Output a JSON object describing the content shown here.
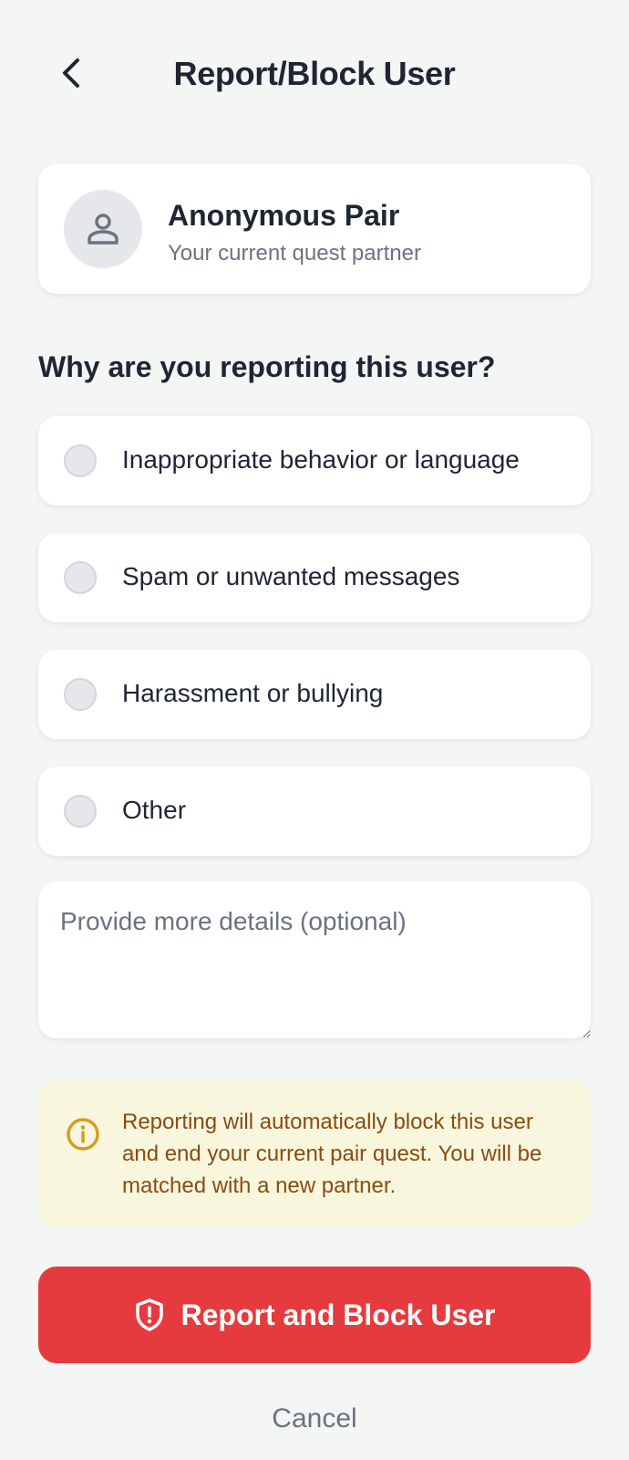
{
  "header": {
    "title": "Report/Block User",
    "back_icon": "chevron-left-icon"
  },
  "user_card": {
    "avatar_icon": "person-icon",
    "name": "Anonymous Pair",
    "subtitle": "Your current quest partner"
  },
  "question": "Why are you reporting this user?",
  "options": [
    {
      "label": "Inappropriate behavior or language",
      "selected": false
    },
    {
      "label": "Spam or unwanted messages",
      "selected": false
    },
    {
      "label": "Harassment or bullying",
      "selected": false
    },
    {
      "label": "Other",
      "selected": false
    }
  ],
  "details": {
    "placeholder": "Provide more details (optional)",
    "value": ""
  },
  "notice": {
    "icon": "info-icon",
    "text": "Reporting will automatically block this user and end your current pair quest. You will be matched with a new partner."
  },
  "actions": {
    "report_label": "Report and Block User",
    "report_icon": "shield-alert-icon",
    "cancel_label": "Cancel"
  },
  "colors": {
    "background": "#f4f5f5",
    "danger": "#e53b3e",
    "notice_bg": "#f8f7de",
    "notice_text": "#8a4b12",
    "notice_icon": "#d69d1e"
  }
}
